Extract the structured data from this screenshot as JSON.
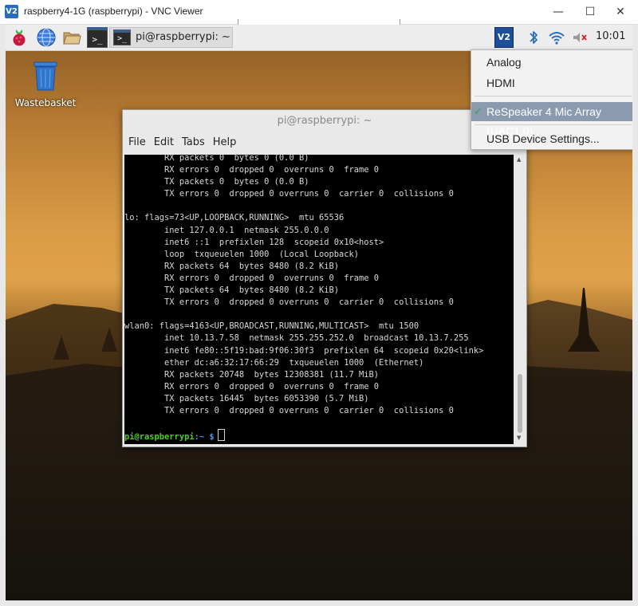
{
  "window": {
    "title": "raspberry4-1G (raspberrypi) - VNC Viewer",
    "logo": "V2",
    "controls": {
      "minimize": "—",
      "maximize": "☐",
      "close": "✕"
    }
  },
  "panel": {
    "launchers": [
      "raspberry-menu-icon",
      "web-browser-icon",
      "file-manager-icon",
      "terminal-icon"
    ],
    "taskbar_item": "pi@raspberrypi: ~",
    "terminal_glyph": ">_",
    "tray": {
      "vnc_glyph": "V2",
      "clock": "10:01"
    }
  },
  "desktop": {
    "icons": [
      {
        "label": "Wastebasket"
      }
    ]
  },
  "terminal": {
    "title": "pi@raspberrypi: ~",
    "menus": [
      "File",
      "Edit",
      "Tabs",
      "Help"
    ],
    "lines": [
      "        RX packets 0  bytes 0 (0.0 B)",
      "        RX errors 0  dropped 0  overruns 0  frame 0",
      "        TX packets 0  bytes 0 (0.0 B)",
      "        TX errors 0  dropped 0 overruns 0  carrier 0  collisions 0",
      "",
      "lo: flags=73<UP,LOOPBACK,RUNNING>  mtu 65536",
      "        inet 127.0.0.1  netmask 255.0.0.0",
      "        inet6 ::1  prefixlen 128  scopeid 0x10<host>",
      "        loop  txqueuelen 1000  (Local Loopback)",
      "        RX packets 64  bytes 8480 (8.2 KiB)",
      "        RX errors 0  dropped 0  overruns 0  frame 0",
      "        TX packets 64  bytes 8480 (8.2 KiB)",
      "        TX errors 0  dropped 0 overruns 0  carrier 0  collisions 0",
      "",
      "wlan0: flags=4163<UP,BROADCAST,RUNNING,MULTICAST>  mtu 1500",
      "        inet 10.13.7.58  netmask 255.255.252.0  broadcast 10.13.7.255",
      "        inet6 fe80::5f19:bad:9f06:30f3  prefixlen 64  scopeid 0x20<link>",
      "        ether dc:a6:32:17:66:29  txqueuelen 1000  (Ethernet)",
      "        RX packets 20748  bytes 12308381 (11.7 MiB)",
      "        RX errors 0  dropped 0  overruns 0  frame 0",
      "        TX packets 16445  bytes 6053390 (5.7 MiB)",
      "        TX errors 0  dropped 0 overruns 0  carrier 0  collisions 0",
      ""
    ],
    "prompt_user": "pi@raspberrypi",
    "prompt_path": ":~ $"
  },
  "audio_menu": {
    "items": [
      "Analog",
      "HDMI",
      "ReSpeaker 4 Mic Array (UAC1.0)",
      "USB Device Settings..."
    ],
    "selected_index": 2,
    "check_glyph": "✓"
  },
  "colors": {
    "prompt_user": "#4fce2a",
    "prompt_path": "#5b8fe8",
    "menu_selected": "#8a9bb0",
    "vnc_blue": "#2a6ebb"
  }
}
